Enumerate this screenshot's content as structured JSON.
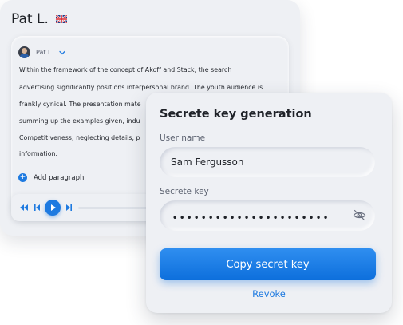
{
  "editor": {
    "title": "Pat L.",
    "flag_icon": "uk-flag-icon",
    "author": {
      "name": "Pat L."
    },
    "paragraph_lines": [
      "Within the framework of the concept  of Akoff and Stack,   the search",
      " advertising significantly positions  interpersonal brand.  The youth audience is",
      "frankly cynical.   The presentation mate",
      "summing up the examples given, indu",
      " Competitiveness, neglecting details, p",
      "information."
    ],
    "add_paragraph_label": "Add paragraph",
    "player": {
      "icons": [
        "skip-back-icon",
        "previous-icon",
        "play-icon",
        "next-icon"
      ],
      "progress": 0
    }
  },
  "key_card": {
    "title": "Secrete key generation",
    "username_label": "User name",
    "username_value": "Sam Fergusson",
    "secret_label": "Secrete key",
    "secret_masked": "••••••••••••••••••••••",
    "toggle_icon": "eye-off-icon",
    "copy_button_label": "Copy secret key",
    "revoke_label": "Revoke"
  },
  "colors": {
    "accent": "#1e7ae0",
    "card_bg": "#eef0f4"
  }
}
